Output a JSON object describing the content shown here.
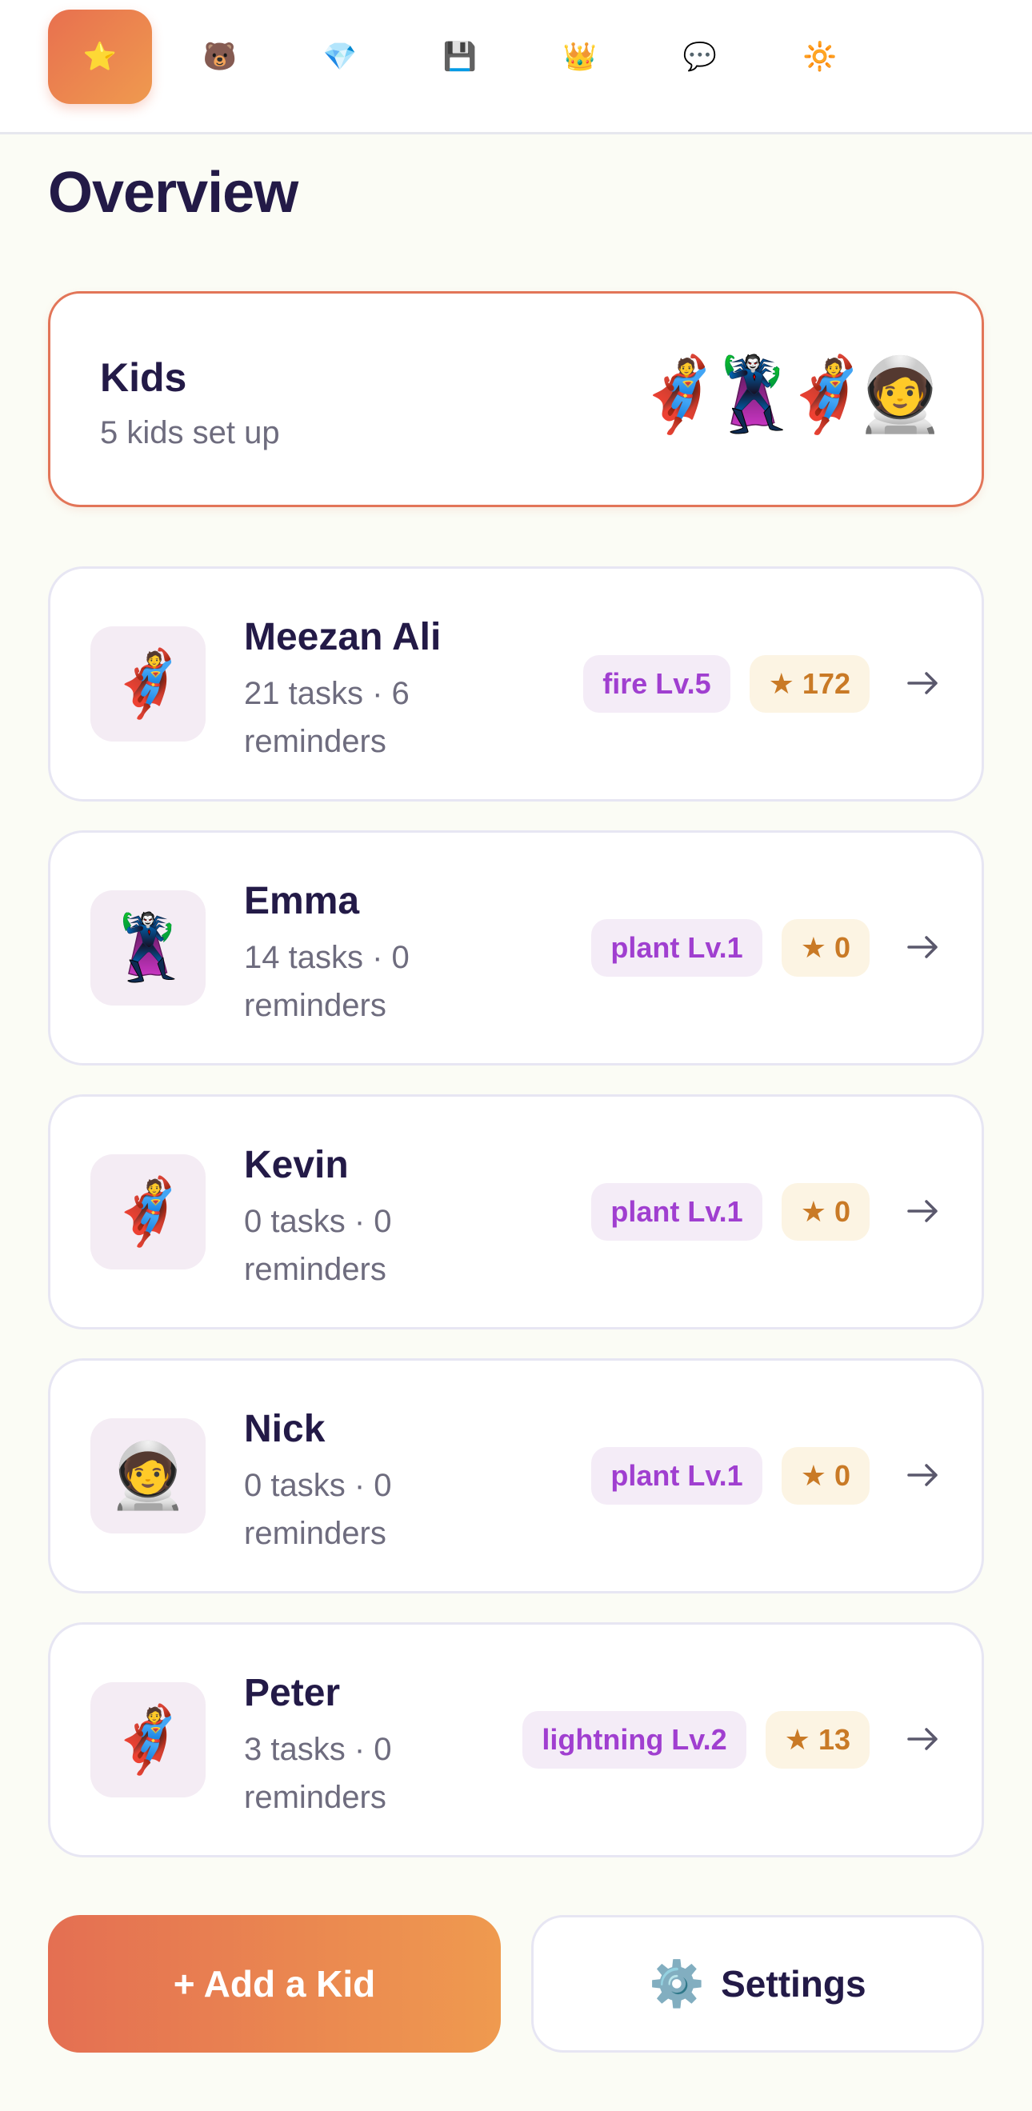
{
  "nav": {
    "tabs": [
      {
        "icon": "star-icon",
        "glyph": "⭐",
        "active": true
      },
      {
        "icon": "bear-icon",
        "glyph": "🐻",
        "active": false
      },
      {
        "icon": "gem-icon",
        "glyph": "💎",
        "active": false
      },
      {
        "icon": "floppy-disk-icon",
        "glyph": "💾",
        "active": false
      },
      {
        "icon": "crown-icon",
        "glyph": "👑",
        "active": false
      },
      {
        "icon": "chat-bubble-icon",
        "glyph": "💬",
        "active": false
      },
      {
        "icon": "sparkle-badge-icon",
        "glyph": "🔆",
        "active": false
      }
    ]
  },
  "page": {
    "title": "Overview"
  },
  "summary": {
    "title": "Kids",
    "subtitle": "5 kids set up",
    "avatars": [
      "🦸",
      "🦹",
      "🦸",
      "🧑‍🚀"
    ]
  },
  "kids": [
    {
      "name": "Meezan Ali",
      "meta": "21 tasks · 6 reminders",
      "avatar": "🦸",
      "pet": "fire Lv.5",
      "stars": "172"
    },
    {
      "name": "Emma",
      "meta": "14 tasks · 0 reminders",
      "avatar": "🦹",
      "pet": "plant Lv.1",
      "stars": "0"
    },
    {
      "name": "Kevin",
      "meta": "0 tasks · 0 reminders",
      "avatar": "🦸",
      "pet": "plant Lv.1",
      "stars": "0"
    },
    {
      "name": "Nick",
      "meta": "0 tasks · 0 reminders",
      "avatar": "🧑‍🚀",
      "pet": "plant Lv.1",
      "stars": "0"
    },
    {
      "name": "Peter",
      "meta": "3 tasks · 0 reminders",
      "avatar": "🦸",
      "pet": "lightning Lv.2",
      "stars": "13"
    }
  ],
  "actions": {
    "add_label": "+ Add a Kid",
    "settings_icon": "⚙️",
    "settings_label": "Settings"
  },
  "colors": {
    "accent": "#e8704f",
    "accent_end": "#ef9a4f",
    "pet_badge_text": "#a03fd0",
    "star_badge_text": "#c97a26",
    "background": "#fbfcf5"
  }
}
